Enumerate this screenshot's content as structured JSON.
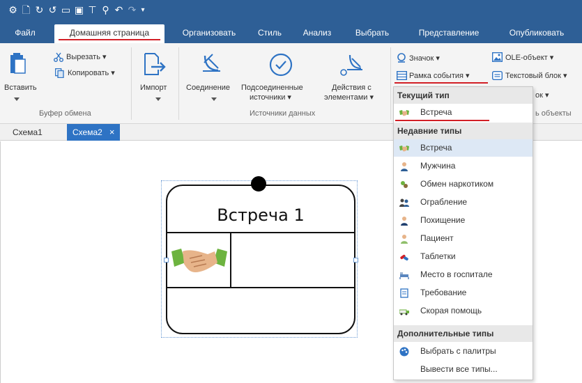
{
  "ribbon_tabs": [
    "Файл",
    "Домашняя страница",
    "Организовать",
    "Стиль",
    "Анализ",
    "Выбрать",
    "Представление",
    "Опубликовать"
  ],
  "ribbon": {
    "cut": "Вырезать",
    "copy": "Копировать",
    "paste": "Вставить",
    "clipboard_group": "Буфер обмена",
    "import": "Импорт",
    "connection": "Соединение",
    "connected_sources_l1": "Подсоединенные",
    "connected_sources_l2": "источники",
    "actions_l1": "Действия с",
    "actions_l2": "элементами",
    "data_sources_group": "Источники данных",
    "badge": "Значок",
    "event_frame": "Рамка события",
    "ole_object": "OLE-объект",
    "text_block": "Текстовый блок",
    "partial_block": "ок",
    "partial_group": "ь объекты"
  },
  "doc_tabs": [
    "Схема1",
    "Схема2"
  ],
  "doc_tab_close": "×",
  "card": {
    "title": "Встреча 1"
  },
  "dropdown": {
    "current_type_header": "Текущий тип",
    "current_type": "Встреча",
    "recent_types_header": "Недавние типы",
    "recent_types": [
      "Встреча",
      "Мужчина",
      "Обмен наркотиком",
      "Ограбление",
      "Похищение",
      "Пациент",
      "Таблетки",
      "Место в госпитале",
      "Требование",
      "Скорая помощь"
    ],
    "additional_types_header": "Дополнительные типы",
    "pick_palette": "Выбрать с палитры",
    "show_all_types": "Вывести все типы..."
  },
  "colors": {
    "title_bar": "#2e5f96",
    "active_doc_tab": "#2e73c4",
    "highlight_underline": "#d21f26",
    "selected_row": "#dde8f5"
  },
  "icons": {
    "quick_access": [
      "settings-icon",
      "new-document-icon",
      "link-icon",
      "link-alt-icon",
      "folder-icon",
      "frame-icon",
      "table-icon",
      "search-icon",
      "undo-icon",
      "redo-icon",
      "customize-dropdown-icon"
    ],
    "ribbon": [
      "paste-icon",
      "scissors-icon",
      "copy-icon",
      "import-icon",
      "connection-icon",
      "checkmark-circle-icon",
      "action-icon",
      "badge-icon",
      "event-frame-icon",
      "ole-object-icon",
      "text-block-icon"
    ],
    "recent_types": [
      "handshake-icon",
      "man-icon",
      "drug-exchange-icon",
      "robbery-icon",
      "kidnap-icon",
      "patient-icon",
      "pills-icon",
      "hospital-bed-icon",
      "document-icon",
      "ambulance-icon"
    ],
    "additional": [
      "palette-icon"
    ]
  }
}
